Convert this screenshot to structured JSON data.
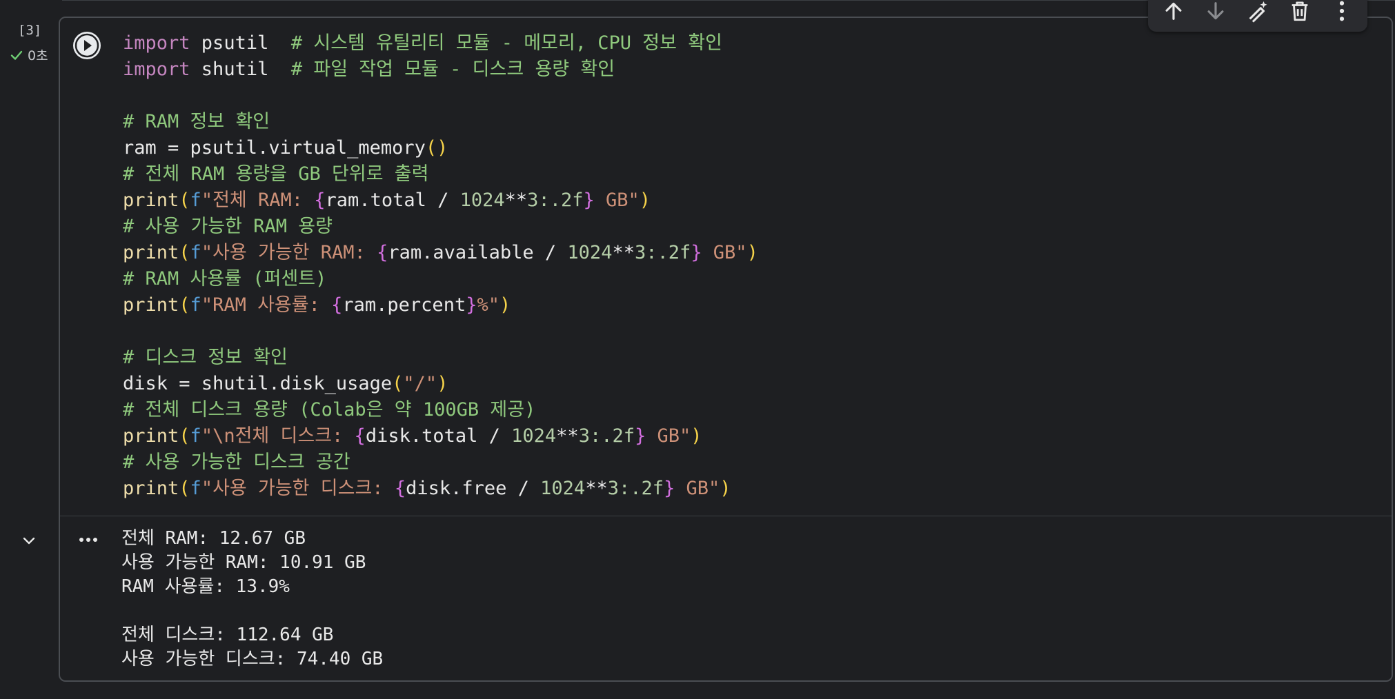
{
  "cell": {
    "execution_count": "[3]",
    "status_time": "0초",
    "code_lines": [
      [
        {
          "t": "import",
          "c": "kw"
        },
        {
          "t": " psutil  ",
          "c": "id"
        },
        {
          "t": "# 시스템 유틸리티 모듈 - 메모리, CPU 정보 확인",
          "c": "cm"
        }
      ],
      [
        {
          "t": "import",
          "c": "kw"
        },
        {
          "t": " shutil  ",
          "c": "id"
        },
        {
          "t": "# 파일 작업 모듈 - 디스크 용량 확인",
          "c": "cm"
        }
      ],
      [],
      [
        {
          "t": "# RAM 정보 확인",
          "c": "cm"
        }
      ],
      [
        {
          "t": "ram = psutil.virtual_memory",
          "c": "id"
        },
        {
          "t": "()",
          "c": "br"
        }
      ],
      [
        {
          "t": "# 전체 RAM 용량을 GB 단위로 출력",
          "c": "cm"
        }
      ],
      [
        {
          "t": "print",
          "c": "fn"
        },
        {
          "t": "(",
          "c": "br"
        },
        {
          "t": "f",
          "c": "fp"
        },
        {
          "t": "\"전체 RAM: ",
          "c": "st"
        },
        {
          "t": "{",
          "c": "cb"
        },
        {
          "t": "ram.total / ",
          "c": "id"
        },
        {
          "t": "1024",
          "c": "num"
        },
        {
          "t": "**",
          "c": "id"
        },
        {
          "t": "3",
          "c": "num"
        },
        {
          "t": ":.2f",
          "c": "num"
        },
        {
          "t": "}",
          "c": "cb"
        },
        {
          "t": " GB\"",
          "c": "st"
        },
        {
          "t": ")",
          "c": "br"
        }
      ],
      [
        {
          "t": "# 사용 가능한 RAM 용량",
          "c": "cm"
        }
      ],
      [
        {
          "t": "print",
          "c": "fn"
        },
        {
          "t": "(",
          "c": "br"
        },
        {
          "t": "f",
          "c": "fp"
        },
        {
          "t": "\"사용 가능한 RAM: ",
          "c": "st"
        },
        {
          "t": "{",
          "c": "cb"
        },
        {
          "t": "ram.available / ",
          "c": "id"
        },
        {
          "t": "1024",
          "c": "num"
        },
        {
          "t": "**",
          "c": "id"
        },
        {
          "t": "3",
          "c": "num"
        },
        {
          "t": ":.2f",
          "c": "num"
        },
        {
          "t": "}",
          "c": "cb"
        },
        {
          "t": " GB\"",
          "c": "st"
        },
        {
          "t": ")",
          "c": "br"
        }
      ],
      [
        {
          "t": "# RAM 사용률 (퍼센트)",
          "c": "cm"
        }
      ],
      [
        {
          "t": "print",
          "c": "fn"
        },
        {
          "t": "(",
          "c": "br"
        },
        {
          "t": "f",
          "c": "fp"
        },
        {
          "t": "\"RAM 사용률: ",
          "c": "st"
        },
        {
          "t": "{",
          "c": "cb"
        },
        {
          "t": "ram.percent",
          "c": "id"
        },
        {
          "t": "}",
          "c": "cb"
        },
        {
          "t": "%\"",
          "c": "st"
        },
        {
          "t": ")",
          "c": "br"
        }
      ],
      [],
      [
        {
          "t": "# 디스크 정보 확인",
          "c": "cm"
        }
      ],
      [
        {
          "t": "disk = shutil.disk_usage",
          "c": "id"
        },
        {
          "t": "(",
          "c": "br"
        },
        {
          "t": "\"/\"",
          "c": "st"
        },
        {
          "t": ")",
          "c": "br"
        }
      ],
      [
        {
          "t": "# 전체 디스크 용량 (Colab은 약 100GB 제공)",
          "c": "cm"
        }
      ],
      [
        {
          "t": "print",
          "c": "fn"
        },
        {
          "t": "(",
          "c": "br"
        },
        {
          "t": "f",
          "c": "fp"
        },
        {
          "t": "\"\\n전체 디스크: ",
          "c": "st"
        },
        {
          "t": "{",
          "c": "cb"
        },
        {
          "t": "disk.total / ",
          "c": "id"
        },
        {
          "t": "1024",
          "c": "num"
        },
        {
          "t": "**",
          "c": "id"
        },
        {
          "t": "3",
          "c": "num"
        },
        {
          "t": ":.2f",
          "c": "num"
        },
        {
          "t": "}",
          "c": "cb"
        },
        {
          "t": " GB\"",
          "c": "st"
        },
        {
          "t": ")",
          "c": "br"
        }
      ],
      [
        {
          "t": "# 사용 가능한 디스크 공간",
          "c": "cm"
        }
      ],
      [
        {
          "t": "print",
          "c": "fn"
        },
        {
          "t": "(",
          "c": "br"
        },
        {
          "t": "f",
          "c": "fp"
        },
        {
          "t": "\"사용 가능한 디스크: ",
          "c": "st"
        },
        {
          "t": "{",
          "c": "cb"
        },
        {
          "t": "disk.free / ",
          "c": "id"
        },
        {
          "t": "1024",
          "c": "num"
        },
        {
          "t": "**",
          "c": "id"
        },
        {
          "t": "3",
          "c": "num"
        },
        {
          "t": ":.2f",
          "c": "num"
        },
        {
          "t": "}",
          "c": "cb"
        },
        {
          "t": " GB\"",
          "c": "st"
        },
        {
          "t": ")",
          "c": "br"
        }
      ]
    ],
    "output_lines": [
      "전체 RAM: 12.67 GB",
      "사용 가능한 RAM: 10.91 GB",
      "RAM 사용률: 13.9%",
      "",
      "전체 디스크: 112.64 GB",
      "사용 가능한 디스크: 74.40 GB"
    ]
  },
  "toolbar": {
    "buttons": [
      {
        "name": "move-up-button",
        "icon": "arrow-up-icon"
      },
      {
        "name": "move-down-button",
        "icon": "arrow-down-icon"
      },
      {
        "name": "edit-ai-button",
        "icon": "magic-pen-icon"
      },
      {
        "name": "delete-button",
        "icon": "trash-icon"
      },
      {
        "name": "more-options-button",
        "icon": "more-vert-icon"
      }
    ]
  },
  "colors": {
    "background": "#1e1f22",
    "keyword": "#c586c0",
    "comment": "#8fc97d",
    "string": "#ce9178",
    "bracket": "#f5d24a",
    "check": "#6fcf74"
  }
}
